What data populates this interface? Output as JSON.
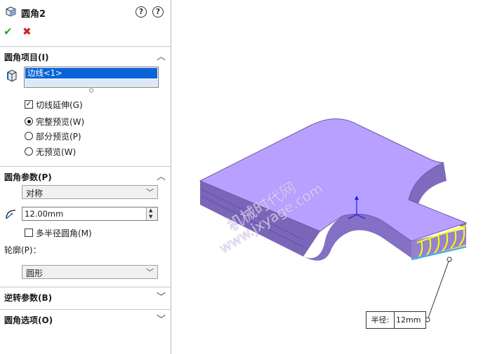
{
  "panel": {
    "title": "圆角2",
    "help_label": "?",
    "pin_label": "?"
  },
  "sections": {
    "fillet_items": {
      "label": "圆角项目(I)",
      "edges_selected": "边线<1>",
      "tangent_propagation": "切线延伸(G)",
      "tangent_checked": true,
      "preview_full": "完整预览(W)",
      "preview_partial": "部分预览(P)",
      "preview_none": "无预览(W)",
      "preview_selected": "full"
    },
    "fillet_params": {
      "label": "圆角参数(P)",
      "type": "对称",
      "radius": "12.00mm",
      "multi_radius": "多半径圆角(M)",
      "multi_radius_checked": false,
      "profile_label": "轮廓(P)：",
      "profile": "圆形"
    },
    "setback": {
      "label": "逆转参数(B)"
    },
    "options": {
      "label": "圆角选项(O)"
    }
  },
  "viewport": {
    "callout_key": "半径:",
    "callout_value": "12mm",
    "watermark_line1": "机械时代网",
    "watermark_line2": "www.jxyage.com"
  },
  "colors": {
    "part_top": "#b7a0ff",
    "part_side": "#8c78c8",
    "fillet_preview": "#ffff00",
    "selection": "#0a64d8"
  }
}
